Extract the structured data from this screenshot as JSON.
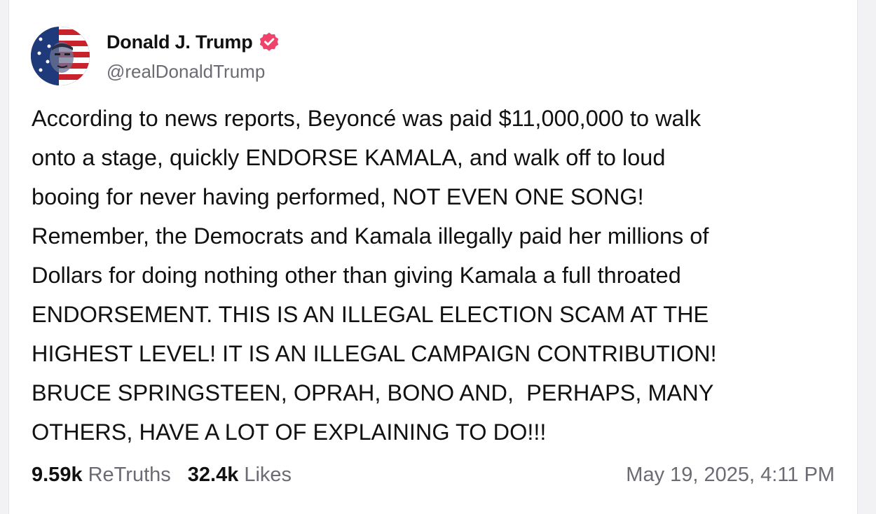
{
  "author": {
    "display_name": "Donald J. Trump",
    "handle": "@realDonaldTrump",
    "verified_color": "#f0436a"
  },
  "post": {
    "text": "According to news reports, Beyoncé was paid $11,000,000 to walk\nonto a stage, quickly ENDORSE KAMALA, and walk off to loud\nbooing for never having performed, NOT EVEN ONE SONG!\nRemember, the Democrats and Kamala illegally paid her millions of\nDollars for doing nothing other than giving Kamala a full throated\nENDORSEMENT. THIS IS AN ILLEGAL ELECTION SCAM AT THE\nHIGHEST LEVEL! IT IS AN ILLEGAL CAMPAIGN CONTRIBUTION!\nBRUCE SPRINGSTEEN, OPRAH, BONO AND,  PERHAPS, MANY\nOTHERS, HAVE A LOT OF EXPLAINING TO DO!!!"
  },
  "stats": {
    "retruths_count": "9.59k",
    "retruths_label": "ReTruths",
    "likes_count": "32.4k",
    "likes_label": "Likes"
  },
  "timestamp": "May 19, 2025, 4:11 PM",
  "icons": {
    "avatar": "avatar-icon",
    "verified": "verified-badge-icon"
  }
}
